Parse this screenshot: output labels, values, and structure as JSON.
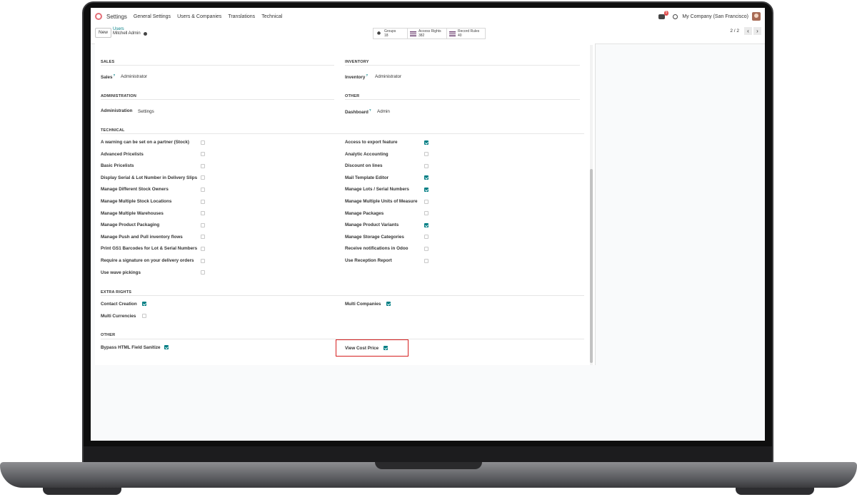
{
  "navbar": {
    "app_title": "Settings",
    "menu": [
      "General Settings",
      "Users & Companies",
      "Translations",
      "Technical"
    ],
    "messages_badge": "5",
    "company": "My Company (San Francisco)"
  },
  "control_panel": {
    "new_label": "New",
    "breadcrumb_parent": "Users",
    "breadcrumb_current": "Mitchell Admin",
    "smart_buttons": [
      {
        "label": "Groups",
        "value": "18"
      },
      {
        "label": "Access Rights",
        "value": "382"
      },
      {
        "label": "Record Rules",
        "value": "40"
      }
    ],
    "pager": "2 / 2"
  },
  "sections": {
    "sales": "SALES",
    "inventory": "INVENTORY",
    "administration": "ADMINISTRATION",
    "other_top": "OTHER",
    "technical": "TECHNICAL",
    "extra_rights": "EXTRA RIGHTS",
    "other_bottom": "OTHER"
  },
  "fields": {
    "sales": {
      "label": "Sales",
      "value": "Administrator",
      "help": "?"
    },
    "inventory": {
      "label": "Inventory",
      "value": "Administrator",
      "help": "?"
    },
    "administration": {
      "label": "Administration",
      "value": "Settings"
    },
    "dashboard": {
      "label": "Dashboard",
      "value": "Admin",
      "help": "?"
    }
  },
  "technical_left": [
    {
      "label": "A warning can be set on a partner (Stock)",
      "checked": false
    },
    {
      "label": "Advanced Pricelists",
      "checked": false
    },
    {
      "label": "Basic Pricelists",
      "checked": false
    },
    {
      "label": "Display Serial & Lot Number in Delivery Slips",
      "checked": false
    },
    {
      "label": "Manage Different Stock Owners",
      "checked": false
    },
    {
      "label": "Manage Multiple Stock Locations",
      "checked": false
    },
    {
      "label": "Manage Multiple Warehouses",
      "checked": false
    },
    {
      "label": "Manage Product Packaging",
      "checked": false
    },
    {
      "label": "Manage Push and Pull inventory flows",
      "checked": false
    },
    {
      "label": "Print GS1 Barcodes for Lot & Serial Numbers",
      "checked": false
    },
    {
      "label": "Require a signature on your delivery orders",
      "checked": false
    },
    {
      "label": "Use wave pickings",
      "checked": false
    }
  ],
  "technical_right": [
    {
      "label": "Access to export feature",
      "checked": true
    },
    {
      "label": "Analytic Accounting",
      "checked": false
    },
    {
      "label": "Discount on lines",
      "checked": false
    },
    {
      "label": "Mail Template Editor",
      "checked": true
    },
    {
      "label": "Manage Lots / Serial Numbers",
      "checked": true
    },
    {
      "label": "Manage Multiple Units of Measure",
      "checked": false
    },
    {
      "label": "Manage Packages",
      "checked": false
    },
    {
      "label": "Manage Product Variants",
      "checked": true
    },
    {
      "label": "Manage Storage Categories",
      "checked": false
    },
    {
      "label": "Receive notifications in Odoo",
      "checked": false
    },
    {
      "label": "Use Reception Report",
      "checked": false
    }
  ],
  "extra_rights": {
    "left": [
      {
        "label": "Contact Creation",
        "checked": true
      },
      {
        "label": "Multi Currencies",
        "checked": false
      }
    ],
    "right": [
      {
        "label": "Multi Companies",
        "checked": true
      }
    ]
  },
  "other_bottom": {
    "left": {
      "label": "Bypass HTML Field Sanitize",
      "checked": true
    },
    "right": {
      "label": "View Cost Price",
      "checked": true
    }
  },
  "colors": {
    "accent": "#017e84",
    "highlight": "#d62020",
    "brand": "#e46f78"
  }
}
